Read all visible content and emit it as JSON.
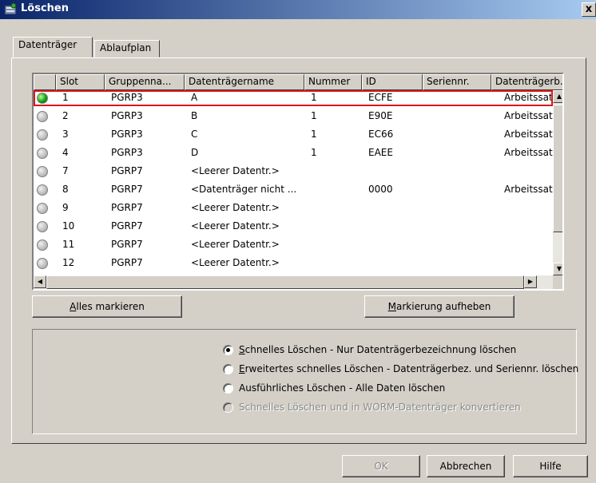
{
  "window": {
    "title": "Löschen",
    "close_label": "x",
    "icon": "tape-library-icon"
  },
  "tabs": [
    {
      "label": "Datenträger"
    },
    {
      "label": "Ablaufplan"
    }
  ],
  "table": {
    "headers": [
      "",
      "Slot",
      "Gruppenna...",
      "Datenträgername",
      "Nummer",
      "ID",
      "Seriennr.",
      "Datenträgerb..."
    ],
    "rows": [
      {
        "status": "on",
        "slot": "1",
        "group": "PGRP3",
        "name": "A",
        "number": "1",
        "id": "ECFE",
        "serial": "",
        "desc": "Arbeitssatz"
      },
      {
        "status": "off",
        "slot": "2",
        "group": "PGRP3",
        "name": "B",
        "number": "1",
        "id": "E90E",
        "serial": "",
        "desc": "Arbeitssatz"
      },
      {
        "status": "off",
        "slot": "3",
        "group": "PGRP3",
        "name": "C",
        "number": "1",
        "id": "EC66",
        "serial": "",
        "desc": "Arbeitssatz"
      },
      {
        "status": "off",
        "slot": "4",
        "group": "PGRP3",
        "name": "D",
        "number": "1",
        "id": "EAEE",
        "serial": "",
        "desc": "Arbeitssatz"
      },
      {
        "status": "off",
        "slot": "7",
        "group": "PGRP7",
        "name": "<Leerer Datentr.>",
        "number": "",
        "id": "",
        "serial": "",
        "desc": ""
      },
      {
        "status": "off",
        "slot": "8",
        "group": "PGRP7",
        "name": "<Datenträger nicht ...",
        "number": "",
        "id": "0000",
        "serial": "",
        "desc": "Arbeitssatz"
      },
      {
        "status": "off",
        "slot": "9",
        "group": "PGRP7",
        "name": "<Leerer Datentr.>",
        "number": "",
        "id": "",
        "serial": "",
        "desc": ""
      },
      {
        "status": "off",
        "slot": "10",
        "group": "PGRP7",
        "name": "<Leerer Datentr.>",
        "number": "",
        "id": "",
        "serial": "",
        "desc": ""
      },
      {
        "status": "off",
        "slot": "11",
        "group": "PGRP7",
        "name": "<Leerer Datentr.>",
        "number": "",
        "id": "",
        "serial": "",
        "desc": ""
      },
      {
        "status": "off",
        "slot": "12",
        "group": "PGRP7",
        "name": "<Leerer Datentr.>",
        "number": "",
        "id": "",
        "serial": "",
        "desc": ""
      }
    ]
  },
  "buttons": {
    "select_all_u": "A",
    "select_all_rest": "lles markieren",
    "deselect_u": "M",
    "deselect_rest": "arkierung aufheben",
    "ok": "OK",
    "cancel": "Abbrechen",
    "help": "Hilfe"
  },
  "options": [
    {
      "u": "S",
      "rest": "chnelles Löschen - Nur Datenträgerbezeichnung löschen",
      "checked": true,
      "disabled": false
    },
    {
      "u": "E",
      "rest": "rweitertes schnelles Löschen - Datenträgerbez. und Seriennr. löschen",
      "checked": false,
      "disabled": false
    },
    {
      "u": "",
      "rest": "Ausführliches Löschen - Alle Daten löschen",
      "checked": false,
      "disabled": false
    },
    {
      "u": "",
      "rest": "Schnelles Löschen und in WORM-Datenträger konvertieren",
      "checked": false,
      "disabled": true
    }
  ]
}
